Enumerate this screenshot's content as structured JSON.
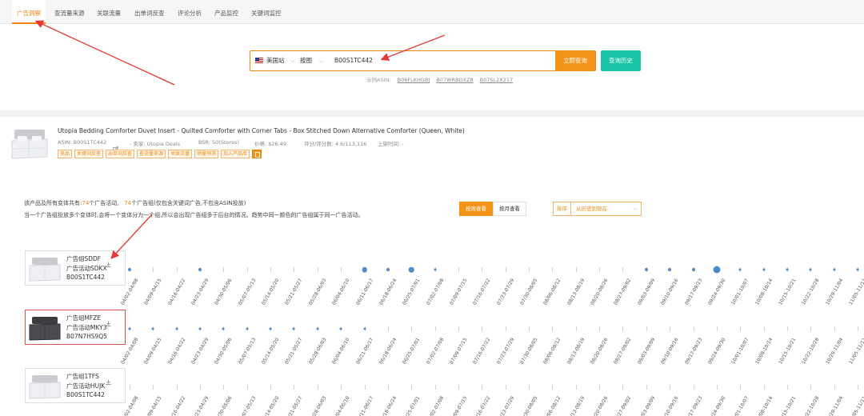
{
  "tabs": [
    {
      "label": "广告洞察",
      "active": true
    },
    {
      "label": "查流量来源"
    },
    {
      "label": "关联流量"
    },
    {
      "label": "出单词反查"
    },
    {
      "label": "评论分析"
    },
    {
      "label": "产品监控"
    },
    {
      "label": "关键词监控"
    }
  ],
  "search": {
    "site": "美国站",
    "mode": "按图",
    "value": "B00S1TC442",
    "submit": "立即查询",
    "history": "查询历史",
    "example_label": "示例ASIN:",
    "examples": [
      "B08FLKHGBJ",
      "B07WRBDXZ8",
      "B07SL2X217"
    ]
  },
  "product": {
    "title": "Utopia Bedding Comforter Duvet Insert - Quilted Comforter with Corner Tabs - Box Stitched Down Alternative Comforter (Queen, White)",
    "asin": "ASIN: B00S1TC442",
    "seller": "- 卖家: Utopia Deals",
    "bsr": "BSR: 50(Stores)",
    "price": "价格: $26.49",
    "rating": "评分/评分数: 4.6/113,116",
    "listed": "上架时间: -",
    "tags": [
      "竞品",
      "关键词反查",
      "出单词反查",
      "查流量来源",
      "关联流量",
      "销量预测",
      "加入产品库"
    ]
  },
  "summary": {
    "line1_a": "该产品及所有变体共有:",
    "campaigns": "74",
    "line1_b": "个广告活动,",
    "groups": "74",
    "line1_c": "个广告组(仅包含关键词广告,不包含ASIN投放)",
    "line2": "当一个广告组投放多个变体时,会将一个变体分为一个组,所以会出现广告组多于后台的情况。趋势中同一颜色的广告组属于同一广告活动。"
  },
  "view": {
    "by_week": "按周查看",
    "by_month": "按月查看",
    "sort_label": "排序",
    "sort_value": "从历史到现在"
  },
  "colors": {
    "accent": "#f39418",
    "teal": "#18c3a6",
    "dot": "#4d8dc7"
  },
  "date_labels": [
    "04/02-04/08",
    "04/09-04/15",
    "04/16-04/22",
    "04/23-04/29",
    "04/30-05/06",
    "05/07-05/13",
    "05/14-05/20",
    "05/21-05/27",
    "05/28-06/03",
    "06/04-06/10",
    "06/11-06/17",
    "06/18-06/24",
    "06/25-07/01",
    "07/02-07/08",
    "07/09-07/15",
    "07/16-07/22",
    "07/23-07/29",
    "07/30-08/05",
    "08/06-08/12",
    "08/13-08/19",
    "08/20-08/26",
    "08/27-09/02",
    "09/03-09/09",
    "09/10-09/16",
    "09/17-09/23",
    "09/24-09/30",
    "10/01-10/07",
    "10/08-10/14",
    "10/15-10/21",
    "10/22-10/28",
    "10/29-11/04",
    "11/05-11/11"
  ],
  "ad_groups": [
    {
      "group": "广告组SDDF",
      "campaign": "广告活动SDKX",
      "asin": "B00S1TC442",
      "image": "white",
      "highlight": false,
      "activity": [
        2,
        0,
        0,
        2,
        0,
        0,
        0,
        0,
        0,
        0,
        3,
        2,
        3,
        1,
        0,
        0,
        0,
        0,
        0,
        0,
        0,
        0,
        2,
        2,
        2,
        4,
        1,
        1,
        1,
        1,
        1,
        1
      ]
    },
    {
      "group": "广告组MFZE",
      "campaign": "广告活动MKY3",
      "asin": "B07N7HS9Q5",
      "image": "dark",
      "highlight": true,
      "activity": [
        1,
        1,
        1,
        1,
        1,
        1,
        1,
        1,
        1,
        1,
        1,
        0,
        0,
        0,
        0,
        0,
        0,
        0,
        0,
        0,
        0,
        0,
        0,
        0,
        0,
        0,
        0,
        0,
        0,
        0,
        0,
        0
      ]
    },
    {
      "group": "广告组1TFS",
      "campaign": "广告活动HUJK",
      "asin": "B00S1TC442",
      "image": "white",
      "highlight": false,
      "activity": [
        0,
        0,
        0,
        0,
        0,
        0,
        0,
        0,
        0,
        0,
        0,
        0,
        0,
        0,
        0,
        0,
        0,
        0,
        0,
        0,
        0,
        0,
        0,
        0,
        0,
        0,
        0,
        0,
        0,
        0,
        0,
        0
      ]
    }
  ]
}
